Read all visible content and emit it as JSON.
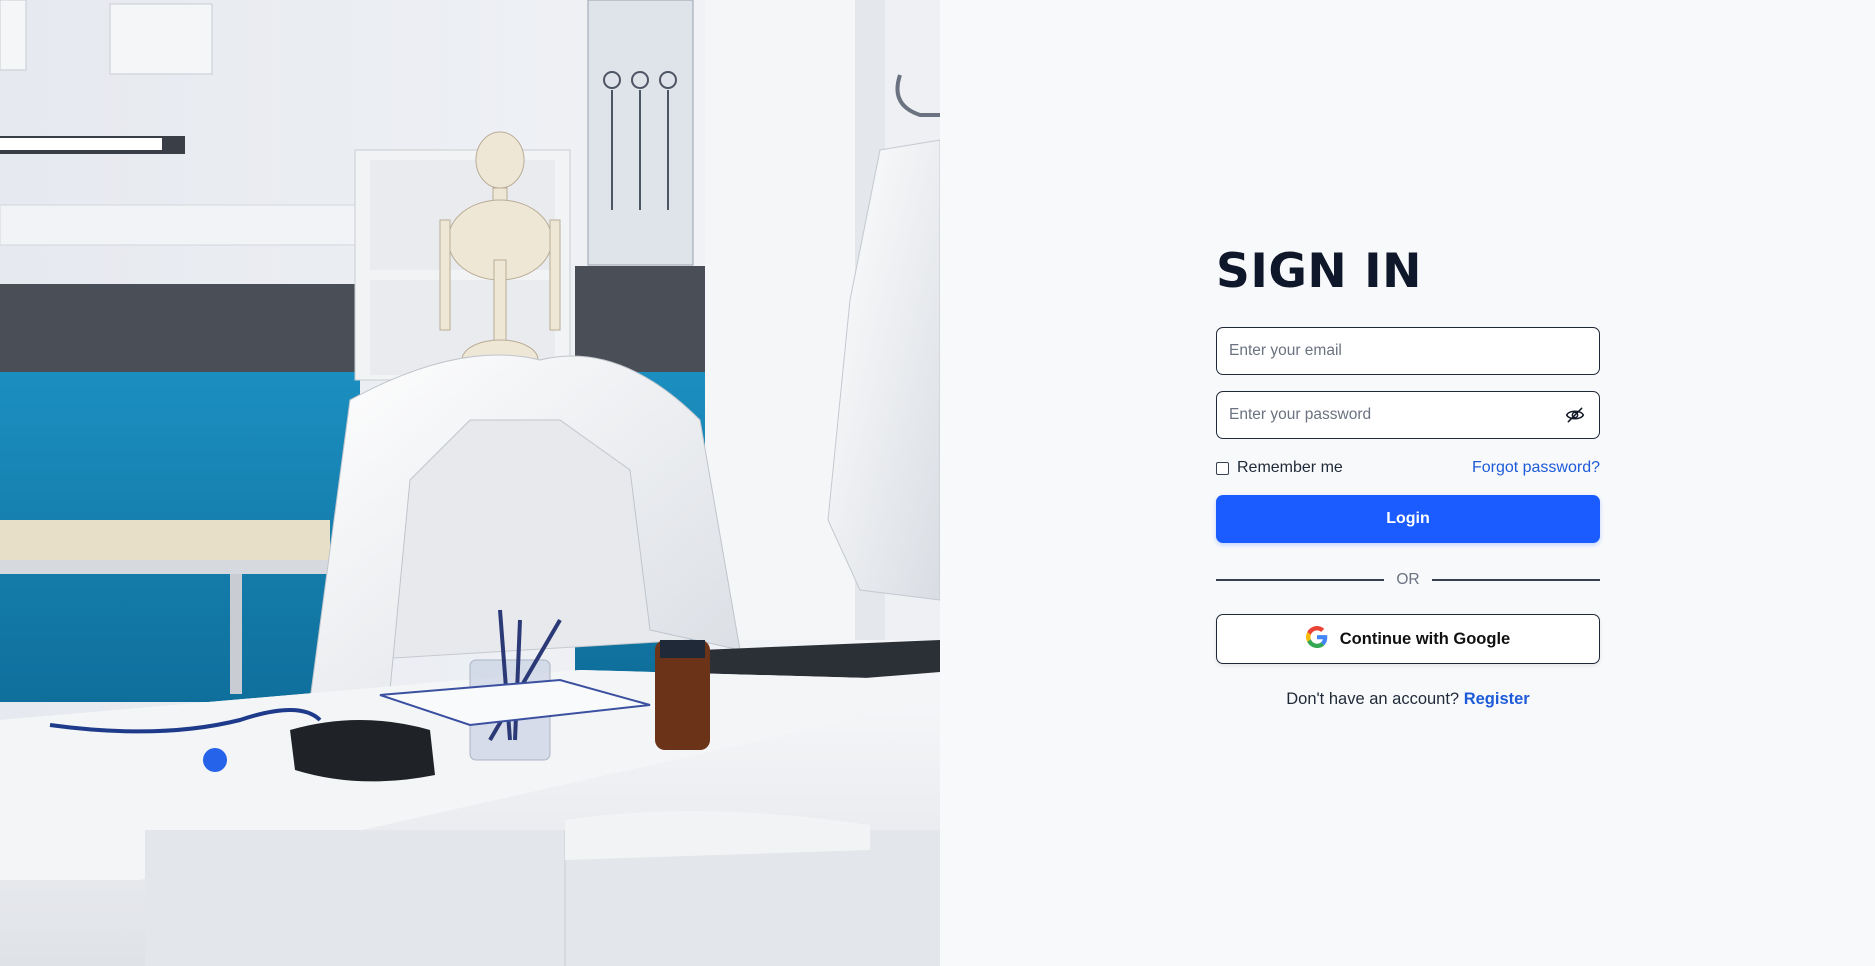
{
  "form": {
    "title": "SIGN IN",
    "email_placeholder": "Enter your email",
    "password_placeholder": "Enter your password",
    "remember_label": "Remember me",
    "forgot_label": "Forgot password?",
    "login_label": "Login",
    "divider_label": "OR",
    "google_label": "Continue with Google",
    "no_account_text": "Don't have an account?",
    "register_label": "Register"
  },
  "icons": {
    "password_toggle": "eye-slash-icon",
    "google": "google-g-logo"
  },
  "colors": {
    "primary": "#1a5cff",
    "link": "#1d5bd8",
    "title": "#0f172a",
    "background": "#f8f9fb"
  }
}
